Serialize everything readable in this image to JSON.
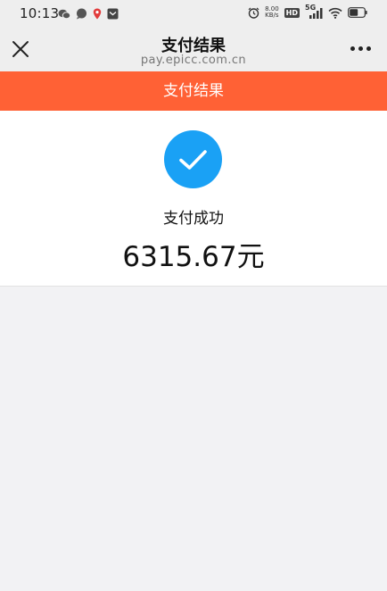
{
  "status_bar": {
    "time": "10:13",
    "net_speed_value": "8.00",
    "net_speed_unit": "KB/s",
    "hd_label": "HD",
    "network_label": "5G",
    "icons": [
      "wechat-icon",
      "message-icon",
      "location-pin-icon",
      "mail-icon",
      "alarm-icon",
      "signal-icon",
      "wifi-icon",
      "battery-icon"
    ]
  },
  "nav": {
    "title": "支付结果",
    "subtitle": "pay.epicc.com.cn",
    "close_icon": "close-icon",
    "more_icon": "more-icon"
  },
  "banner": {
    "title": "支付结果"
  },
  "result": {
    "icon": "checkmark-icon",
    "status": "支付成功",
    "amount": "6315.67元"
  },
  "colors": {
    "banner": "#ff6135",
    "success_icon": "#1aa1f5",
    "page_background": "#f2f2f4",
    "bar_background": "#eeeeee"
  }
}
